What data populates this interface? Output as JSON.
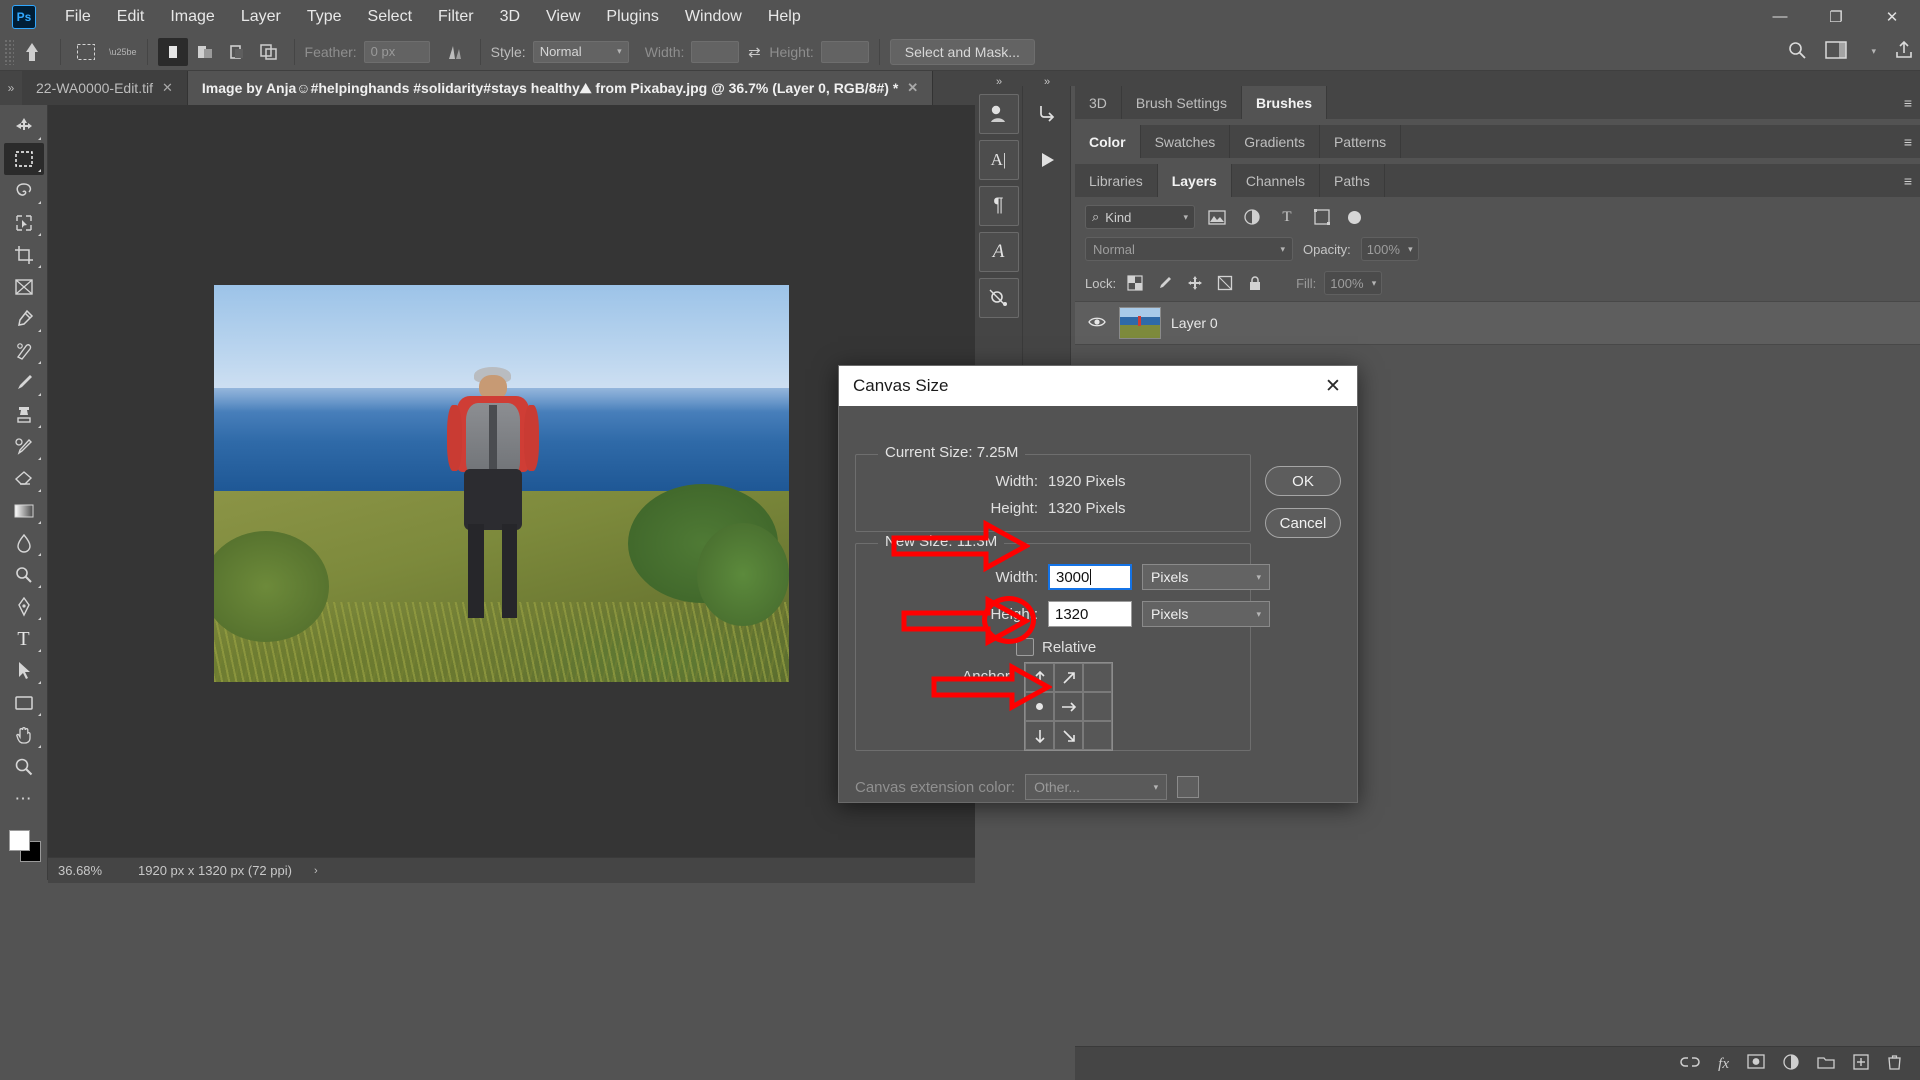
{
  "app": {
    "name": "Adobe Photoshop",
    "logo_text": "Ps"
  },
  "menubar": {
    "items": [
      {
        "label": "File"
      },
      {
        "label": "Edit"
      },
      {
        "label": "Image"
      },
      {
        "label": "Layer"
      },
      {
        "label": "Type"
      },
      {
        "label": "Select"
      },
      {
        "label": "Filter"
      },
      {
        "label": "3D"
      },
      {
        "label": "View"
      },
      {
        "label": "Plugins"
      },
      {
        "label": "Window"
      },
      {
        "label": "Help"
      }
    ],
    "window_controls": {
      "minimize": "—",
      "restore": "❐",
      "close": "✕"
    }
  },
  "options_bar": {
    "feather_label": "Feather:",
    "feather_value": "0 px",
    "style_label": "Style:",
    "style_value": "Normal",
    "width_label": "Width:",
    "width_value": "",
    "height_label": "Height:",
    "height_value": "",
    "swap_icon": "⇄",
    "select_and_mask": "Select and Mask...",
    "search_icon": "search-icon",
    "workspace_icon": "workspace-icon",
    "share_icon": "share-icon"
  },
  "tabs": {
    "overflow_icon": "»",
    "items": [
      {
        "label": "22-WA0000-Edit.tif",
        "close": "✕",
        "active": false
      },
      {
        "label": "Image by Anja☺#helpinghands #solidarity#stays healthy⛰ from Pixabay.jpg @ 36.7% (Layer 0, RGB/8#) *",
        "close": "✕",
        "active": true
      }
    ]
  },
  "toolbar": {
    "tools": [
      {
        "name": "move-tool",
        "glyph": "✛"
      },
      {
        "name": "rectangular-marquee-tool",
        "glyph": "⬚",
        "active": true
      },
      {
        "name": "lasso-tool",
        "glyph": "❀"
      },
      {
        "name": "object-selection-tool",
        "glyph": "✐"
      },
      {
        "name": "crop-tool",
        "glyph": "⌗"
      },
      {
        "name": "frame-tool",
        "glyph": "⌧"
      },
      {
        "name": "eyedropper-tool",
        "glyph": "⚗"
      },
      {
        "name": "spot-healing-brush-tool",
        "glyph": "❖"
      },
      {
        "name": "brush-tool",
        "glyph": "✎"
      },
      {
        "name": "clone-stamp-tool",
        "glyph": "⚓"
      },
      {
        "name": "history-brush-tool",
        "glyph": "✒"
      },
      {
        "name": "eraser-tool",
        "glyph": "◥"
      },
      {
        "name": "gradient-tool",
        "glyph": "▣"
      },
      {
        "name": "blur-tool",
        "glyph": "◖"
      },
      {
        "name": "dodge-tool",
        "glyph": "●"
      },
      {
        "name": "pen-tool",
        "glyph": "✑"
      },
      {
        "name": "horizontal-type-tool",
        "glyph": "T"
      },
      {
        "name": "path-selection-tool",
        "glyph": "➤"
      },
      {
        "name": "rectangle-tool",
        "glyph": "▭"
      },
      {
        "name": "hand-tool",
        "glyph": "✋"
      },
      {
        "name": "zoom-tool",
        "glyph": "⌕"
      },
      {
        "name": "edit-toolbar",
        "glyph": "⋯"
      }
    ],
    "foreground_color": "#ffffff",
    "background_color": "#000000"
  },
  "status_bar": {
    "zoom": "36.68%",
    "doc_info": "1920 px x 1320 px (72 ppi)",
    "arrow": "›"
  },
  "right_dock": {
    "mini_tools_a": [
      {
        "name": "adjustments-icon",
        "glyph": "◨"
      },
      {
        "name": "character-icon",
        "glyph": "A|"
      },
      {
        "name": "paragraph-icon",
        "glyph": "¶"
      },
      {
        "name": "glyphs-icon",
        "glyph": "A"
      },
      {
        "name": "histogram-icon",
        "glyph": "⌘"
      }
    ],
    "mini_tools_b": [
      {
        "name": "actions-icon",
        "glyph": "↱"
      },
      {
        "name": "play-icon",
        "glyph": "▶"
      }
    ],
    "panel_groups": [
      {
        "tabs": [
          {
            "label": "3D",
            "active": false
          },
          {
            "label": "Brush Settings",
            "active": false
          },
          {
            "label": "Brushes",
            "active": true
          }
        ]
      },
      {
        "tabs": [
          {
            "label": "Color",
            "active": true
          },
          {
            "label": "Swatches",
            "active": false
          },
          {
            "label": "Gradients",
            "active": false
          },
          {
            "label": "Patterns",
            "active": false
          }
        ]
      },
      {
        "tabs": [
          {
            "label": "Libraries",
            "active": false
          },
          {
            "label": "Layers",
            "active": true
          },
          {
            "label": "Channels",
            "active": false
          },
          {
            "label": "Paths",
            "active": false
          }
        ]
      }
    ],
    "panel_menu_icon": "≡"
  },
  "layers_panel": {
    "filter_kind_label": "Kind",
    "search_icon": "⌕",
    "filter_icons": [
      {
        "name": "filter-image-icon",
        "glyph": "◰"
      },
      {
        "name": "filter-adjustment-icon",
        "glyph": "◑"
      },
      {
        "name": "filter-type-icon",
        "glyph": "T"
      },
      {
        "name": "filter-shape-icon",
        "glyph": "⬚"
      },
      {
        "name": "filter-smart-object-icon",
        "glyph": "❐"
      }
    ],
    "blend_mode": "Normal",
    "opacity_label": "Opacity:",
    "opacity_value": "100%",
    "lock_label": "Lock:",
    "lock_icons": [
      {
        "name": "lock-transparency-icon",
        "glyph": "⛶"
      },
      {
        "name": "lock-image-pixels-icon",
        "glyph": "✎"
      },
      {
        "name": "lock-position-icon",
        "glyph": "✛"
      },
      {
        "name": "lock-nesting-icon",
        "glyph": "⬚"
      },
      {
        "name": "lock-all-icon",
        "glyph": "⚿"
      }
    ],
    "fill_label": "Fill:",
    "fill_value": "100%",
    "layers": [
      {
        "name": "Layer 0",
        "visible": true,
        "eye_icon": "◉"
      }
    ],
    "footer_icons": [
      {
        "name": "link-layers-icon",
        "glyph": "⚭"
      },
      {
        "name": "layer-style-icon",
        "glyph": "fx"
      },
      {
        "name": "layer-mask-icon",
        "glyph": "▣"
      },
      {
        "name": "adjustment-layer-icon",
        "glyph": "◐"
      },
      {
        "name": "new-group-icon",
        "glyph": "▱"
      },
      {
        "name": "new-layer-icon",
        "glyph": "⊞"
      },
      {
        "name": "delete-layer-icon",
        "glyph": "Ὕ1"
      }
    ]
  },
  "canvas_size_dialog": {
    "title": "Canvas Size",
    "close_icon": "✕",
    "current_size": {
      "legend": "Current Size: 7.25M",
      "width_label": "Width:",
      "width_value": "1920 Pixels",
      "height_label": "Height:",
      "height_value": "1320 Pixels"
    },
    "new_size": {
      "legend": "New Size: 11.3M",
      "width_label": "Width:",
      "width_value": "3000",
      "width_unit": "Pixels",
      "height_label": "Height:",
      "height_value": "1320",
      "height_unit": "Pixels",
      "relative_label": "Relative",
      "relative_checked": false,
      "anchor_label": "Anchor:",
      "anchor_cells": [
        {
          "name": "anchor-top-left",
          "glyph": "↑"
        },
        {
          "name": "anchor-top-center",
          "glyph": "↗"
        },
        {
          "name": "anchor-top-right",
          "glyph": ""
        },
        {
          "name": "anchor-middle-left",
          "glyph": "●"
        },
        {
          "name": "anchor-middle-center",
          "glyph": "→"
        },
        {
          "name": "anchor-middle-right",
          "glyph": ""
        },
        {
          "name": "anchor-bottom-left",
          "glyph": "↓"
        },
        {
          "name": "anchor-bottom-center",
          "glyph": "↘"
        },
        {
          "name": "anchor-bottom-right",
          "glyph": ""
        }
      ]
    },
    "extension": {
      "label": "Canvas extension color:",
      "value": "Other...",
      "swatch_color": "#5e5e5e"
    },
    "buttons": {
      "ok": "OK",
      "cancel": "Cancel"
    }
  },
  "annotations": {
    "color": "#ff0000",
    "arrows": [
      {
        "name": "arrow-pointing-to-width-field"
      },
      {
        "name": "arrow-pointing-to-relative-checkbox"
      },
      {
        "name": "arrow-pointing-to-anchor-grid"
      }
    ],
    "circles": [
      {
        "name": "circle-around-relative-checkbox"
      }
    ]
  },
  "colors": {
    "chrome": "#535353",
    "panel": "#454545",
    "canvas_bg": "#353535",
    "accent_blue": "#31a8ff",
    "focus_blue": "#1473e6",
    "annotation_red": "#ff0000"
  }
}
